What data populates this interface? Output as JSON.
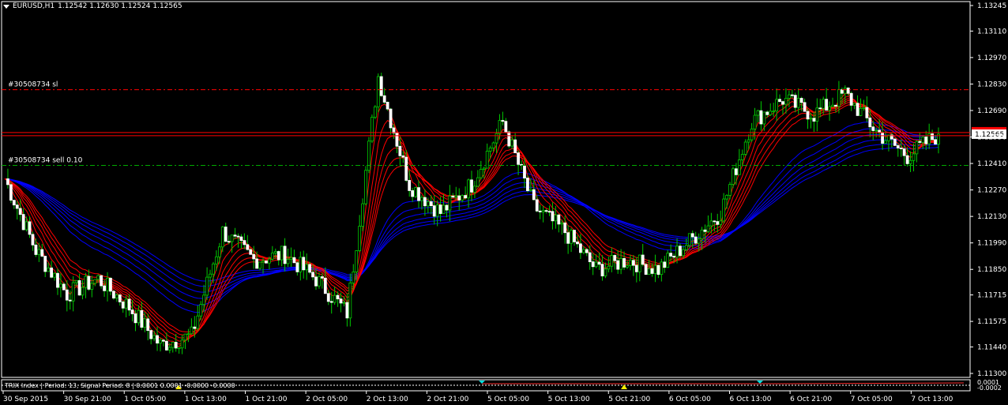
{
  "header": {
    "symbol": "EURUSD,H1",
    "ohlc": "1.12542 1.12630 1.12524 1.12565"
  },
  "indicator": {
    "label": "TRIX Index | Period: 13, Signal Period: 8 |  0.0001 0.0001 -0.0000 -0.0000",
    "scale_top": "0.0001",
    "scale_bottom": "-0.0002"
  },
  "orders": {
    "sl_label": "#30508734 sl",
    "sl_price": 1.128,
    "entry_label": "#30508734 sell 0.10",
    "entry_price": 1.124
  },
  "colors": {
    "background": "#000000",
    "grid_frame": "#ffffff",
    "bull_candle": "#00cc00",
    "bear_candle": "#ffffff",
    "fast_ribbon": "#ff0000",
    "slow_ribbon": "#0000ff",
    "sl_line": "#ff0000",
    "entry_line": "#00aa00",
    "current_price_bg": "#ffffff",
    "current_price_line": "#ff0000"
  },
  "chart_data": {
    "type": "candlestick",
    "title": "EURUSD,H1",
    "ylim": [
      1.113,
      1.13245
    ],
    "y_ticks": [
      "1.13245",
      "1.13110",
      "1.12970",
      "1.12830",
      "1.12690",
      "1.12550",
      "1.12410",
      "1.12270",
      "1.12130",
      "1.11990",
      "1.11850",
      "1.11715",
      "1.11575",
      "1.11440",
      "1.11300"
    ],
    "x_ticks": [
      "30 Sep 2015",
      "30 Sep 21:00",
      "1 Oct 05:00",
      "1 Oct 13:00",
      "1 Oct 21:00",
      "2 Oct 05:00",
      "2 Oct 13:00",
      "2 Oct 21:00",
      "5 Oct 05:00",
      "5 Oct 13:00",
      "5 Oct 21:00",
      "6 Oct 05:00",
      "6 Oct 13:00",
      "6 Oct 21:00",
      "7 Oct 05:00",
      "7 Oct 13:00"
    ],
    "current_price": "1.12565",
    "price_path": [
      [
        "30 Sep 13:00",
        1.1233
      ],
      [
        "30 Sep 17:00",
        1.1195
      ],
      [
        "30 Sep 21:00",
        1.1172
      ],
      [
        "1 Oct 01:00",
        1.118
      ],
      [
        "1 Oct 05:00",
        1.1165
      ],
      [
        "1 Oct 09:00",
        1.1145
      ],
      [
        "1 Oct 13:00",
        1.115
      ],
      [
        "1 Oct 17:00",
        1.1205
      ],
      [
        "1 Oct 21:00",
        1.119
      ],
      [
        "2 Oct 01:00",
        1.1193
      ],
      [
        "2 Oct 05:00",
        1.118
      ],
      [
        "2 Oct 09:00",
        1.1162
      ],
      [
        "2 Oct 13:00",
        1.1287
      ],
      [
        "2 Oct 17:00",
        1.123
      ],
      [
        "2 Oct 21:00",
        1.1215
      ],
      [
        "5 Oct 01:00",
        1.123
      ],
      [
        "5 Oct 05:00",
        1.1263
      ],
      [
        "5 Oct 09:00",
        1.1218
      ],
      [
        "5 Oct 13:00",
        1.1205
      ],
      [
        "5 Oct 17:00",
        1.1185
      ],
      [
        "5 Oct 21:00",
        1.119
      ],
      [
        "6 Oct 01:00",
        1.1185
      ],
      [
        "6 Oct 05:00",
        1.12
      ],
      [
        "6 Oct 09:00",
        1.1215
      ],
      [
        "6 Oct 13:00",
        1.1263
      ],
      [
        "6 Oct 17:00",
        1.1275
      ],
      [
        "6 Oct 21:00",
        1.1267
      ],
      [
        "7 Oct 01:00",
        1.1278
      ],
      [
        "7 Oct 05:00",
        1.1258
      ],
      [
        "7 Oct 09:00",
        1.1245
      ],
      [
        "7 Oct 13:00",
        1.12565
      ]
    ]
  }
}
